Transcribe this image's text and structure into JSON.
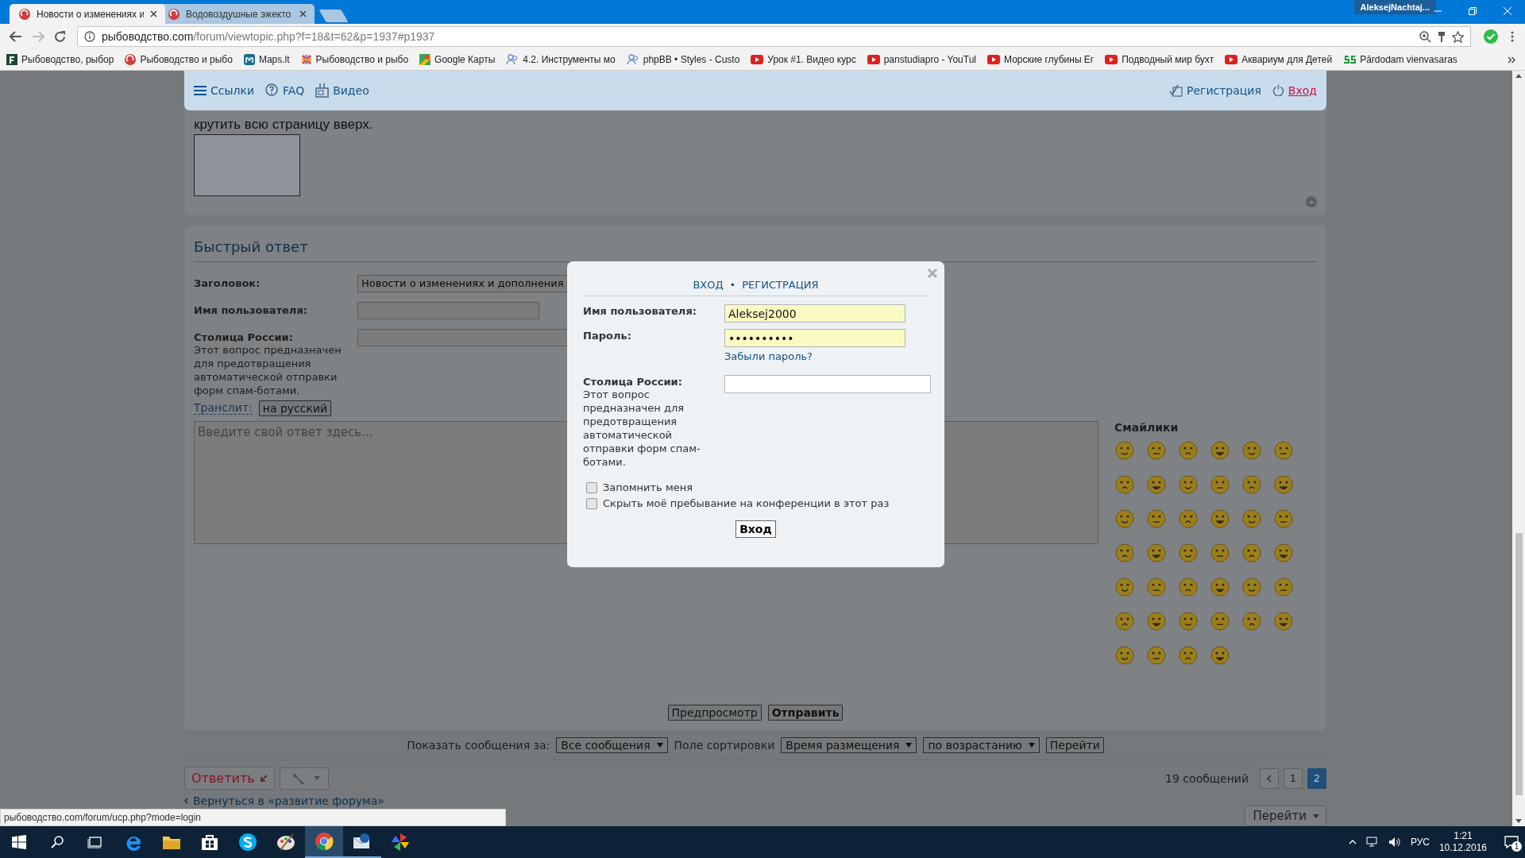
{
  "browser": {
    "tabs": [
      {
        "title": "Новости о изменениях и",
        "selected": true
      },
      {
        "title": "Водовоздушные эжекто",
        "selected": false
      }
    ],
    "profile": "AleksejNachtaj...",
    "address": {
      "host": "рыбоводство.com",
      "path": "/forum/viewtopic.php?f=18&t=62&p=1937#p1937"
    },
    "bookmarks": [
      {
        "label": "Рыбоводство, рыбор",
        "kind": "letter"
      },
      {
        "label": "Рыбоводство и рыбо",
        "kind": "forum"
      },
      {
        "label": "Maps.lt",
        "kind": "maps"
      },
      {
        "label": "Рыбоводство и рыбо",
        "kind": "joomla"
      },
      {
        "label": "Google Карты",
        "kind": "gmaps"
      },
      {
        "label": "4.2. Инструменты мо",
        "kind": "people"
      },
      {
        "label": "phpBB • Styles - Custo",
        "kind": "people"
      },
      {
        "label": "Урок #1. Видео курс",
        "kind": "video"
      },
      {
        "label": "panstudiapro - YouTul",
        "kind": "video"
      },
      {
        "label": "Морские глубины Ег",
        "kind": "video"
      },
      {
        "label": "Подводный мир бухт",
        "kind": "video"
      },
      {
        "label": "Аквариум для Детей",
        "kind": "video"
      },
      {
        "label": "Pārdodam vienvasaras",
        "kind": "ss"
      }
    ]
  },
  "navbar": {
    "left": [
      {
        "label": "Ссылки",
        "kind": "menu"
      },
      {
        "label": "FAQ",
        "kind": "faq"
      },
      {
        "label": "Видео",
        "kind": "video"
      }
    ],
    "right": [
      {
        "label": "Регистрация",
        "kind": "register"
      },
      {
        "label": "Вход",
        "kind": "login"
      }
    ]
  },
  "post": {
    "text": "крутить всю страницу вверх."
  },
  "quick_reply": {
    "title": "Быстрый ответ",
    "fields": [
      {
        "label": "Заголовок:",
        "value": "Новости о изменениях и дополнения"
      },
      {
        "label": "Имя пользователя:"
      },
      {
        "label": "Столица России:",
        "hint": "Этот вопрос предназначен для предотвращения автоматической отправки форм спам-ботами."
      }
    ],
    "translit": {
      "label": "Транслит:",
      "button": "на русский"
    },
    "message": {
      "placeholder": "Введите свой ответ здесь..."
    },
    "smilies_title": "Смайлики",
    "buttons": [
      {
        "label": "Предпросмотр",
        "primary": false
      },
      {
        "label": "Отправить",
        "primary": true
      }
    ]
  },
  "sort_bar": {
    "show_label": "Показать сообщения за:",
    "show_value": "Все сообщения",
    "sort_label": "Поле сортировки",
    "sort_value": "Время размещения",
    "order_value": "по возрастанию",
    "go": "Перейти"
  },
  "actions": {
    "reply": "Ответить",
    "count": "19 сообщений",
    "pages": [
      {
        "label": "1",
        "selected": false
      },
      {
        "label": "2",
        "selected": true
      }
    ],
    "back": "Вернуться в «развитие форума»",
    "jump": "Перейти"
  },
  "status_url": "рыбоводство.com/forum/ucp.php?mode=login",
  "modal": {
    "tabs": [
      "ВХОД",
      "РЕГИСТРАЦИЯ"
    ],
    "separator": "•",
    "username": {
      "label": "Имя пользователя:",
      "value": "Aleksej2000"
    },
    "password": {
      "label": "Пароль:",
      "value": "••••••••••"
    },
    "forgot": "Забыли пароль?",
    "captcha": {
      "label": "Столица России:",
      "hint": "Этот вопрос предназначен для предотвращения автоматической отправки форм спам-ботами."
    },
    "checkboxes": [
      {
        "label": "Запомнить меня",
        "checked": false
      },
      {
        "label": "Скрыть моё пребывание на конференции в этот раз",
        "checked": false
      }
    ],
    "submit": "Вход"
  },
  "taskbar": {
    "apps": [
      {
        "kind": "explorer-edge",
        "selected": false,
        "running": false
      },
      {
        "kind": "folder",
        "selected": false,
        "running": false
      },
      {
        "kind": "store",
        "selected": false,
        "running": false
      },
      {
        "kind": "skype",
        "selected": false,
        "running": false
      },
      {
        "kind": "paint",
        "selected": false,
        "running": false
      },
      {
        "kind": "chrome",
        "selected": true,
        "running": true
      },
      {
        "kind": "mail",
        "selected": false,
        "running": true
      },
      {
        "kind": "photos",
        "selected": false,
        "running": false
      }
    ],
    "lang": "РУС",
    "time": "1:21",
    "date": "10.12.2016",
    "notifications": "1"
  }
}
